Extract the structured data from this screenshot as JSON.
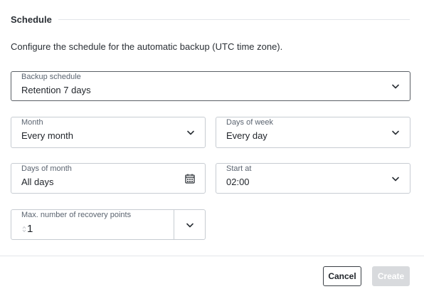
{
  "section": {
    "title": "Schedule",
    "description": "Configure the schedule for the automatic backup (UTC time zone)."
  },
  "fields": {
    "backup_schedule": {
      "label": "Backup schedule",
      "value": "Retention 7 days"
    },
    "month": {
      "label": "Month",
      "value": "Every month"
    },
    "days_of_week": {
      "label": "Days of week",
      "value": "Every day"
    },
    "days_of_month": {
      "label": "Days of month",
      "value": "All days"
    },
    "start_at": {
      "label": "Start at",
      "value": "02:00"
    },
    "recovery_points": {
      "label": "Max. number of recovery points",
      "value": "1"
    }
  },
  "footer": {
    "cancel_label": "Cancel",
    "create_label": "Create"
  },
  "colors": {
    "border": "#c7ccd2",
    "active_border": "#5b6066",
    "disabled_button": "#d8dadd"
  }
}
